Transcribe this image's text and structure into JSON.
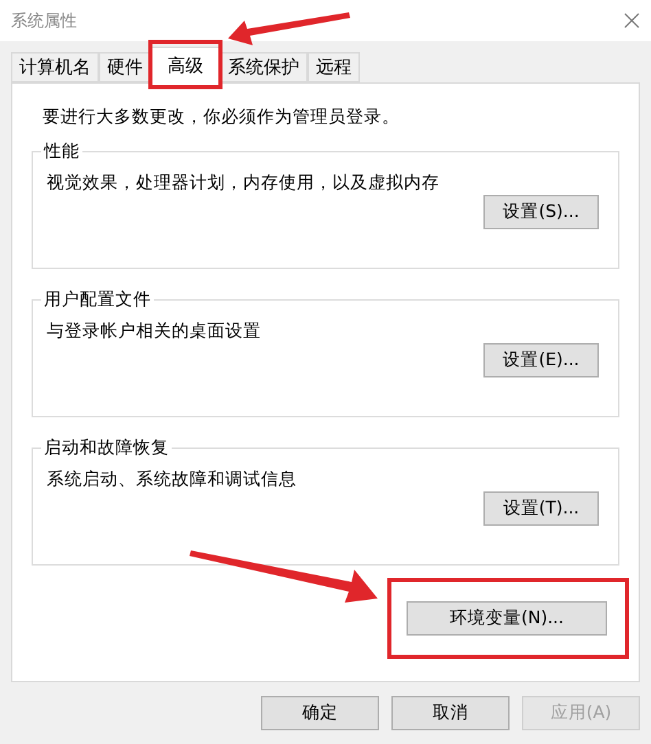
{
  "window": {
    "title": "系统属性"
  },
  "tabs": [
    {
      "label": "计算机名",
      "selected": false,
      "highlighted": false
    },
    {
      "label": "硬件",
      "selected": false,
      "highlighted": false
    },
    {
      "label": "高级",
      "selected": true,
      "highlighted": true
    },
    {
      "label": "系统保护",
      "selected": false,
      "highlighted": false
    },
    {
      "label": "远程",
      "selected": false,
      "highlighted": false
    }
  ],
  "notice": "要进行大多数更改，你必须作为管理员登录。",
  "groups": [
    {
      "title": "性能",
      "description": "视觉效果，处理器计划，内存使用，以及虚拟内存",
      "button": "设置(S)..."
    },
    {
      "title": "用户配置文件",
      "description": "与登录帐户相关的桌面设置",
      "button": "设置(E)..."
    },
    {
      "title": "启动和故障恢复",
      "description": "系统启动、系统故障和调试信息",
      "button": "设置(T)..."
    }
  ],
  "env_button": {
    "label": "环境变量(N)...",
    "highlighted": true
  },
  "buttons": [
    {
      "label": "确定",
      "disabled": false
    },
    {
      "label": "取消",
      "disabled": false
    },
    {
      "label": "应用(A)",
      "disabled": true
    }
  ]
}
